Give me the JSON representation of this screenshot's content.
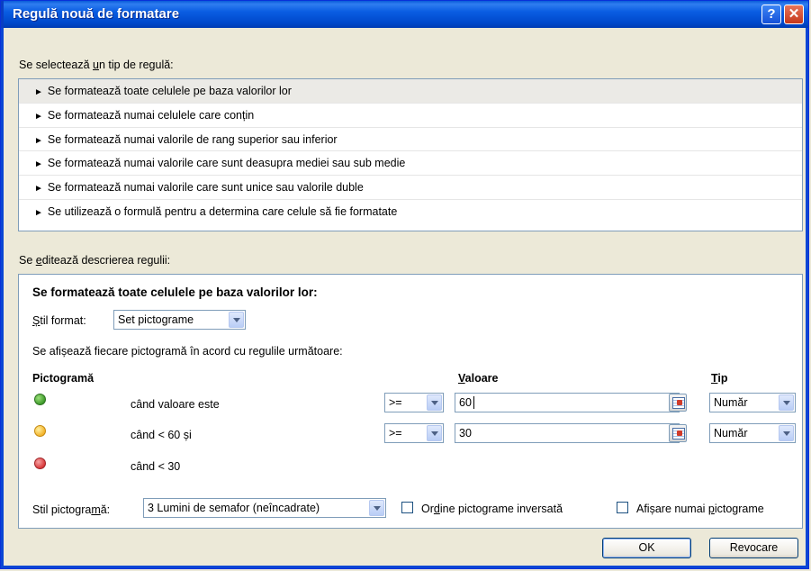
{
  "window": {
    "title": "Regulă nouă de formatare"
  },
  "titlebar": {
    "help_glyph": "?",
    "close_glyph": "✕"
  },
  "rule_type": {
    "label_pre": "Se selectează ",
    "label_key": "u",
    "label_post": "n tip de regulă:",
    "items": [
      "Se formatează toate celulele pe baza valorilor lor",
      "Se formatează numai celulele care conțin",
      "Se formatează numai valorile de rang superior sau inferior",
      "Se formatează numai valorile care sunt deasupra mediei sau sub medie",
      "Se formatează numai valorile care sunt unice sau valorile duble",
      "Se utilizează o formulă pentru a determina care celule să fie formatate"
    ],
    "selected_index": 0,
    "arrow_glyph": "►"
  },
  "description": {
    "label_pre": "Se ",
    "label_key": "e",
    "label_post": "ditează descrierea regulii:",
    "title": "Se formatează toate celulele pe baza valorilor lor:",
    "format_style_label_key": "Ș",
    "format_style_label_post": "til format:",
    "format_style_value": "Set pictograme",
    "rules_caption": "Se afișează fiecare pictogramă în acord cu regulile următoare:",
    "col_icon": "Pictogramă",
    "col_value_key": "V",
    "col_value_post": "aloare",
    "col_type_key": "T",
    "col_type_post": "ip",
    "rows": [
      {
        "icon": "green-light-icon",
        "condition": "când valoare este",
        "operator": ">=",
        "value": "60",
        "type": "Număr"
      },
      {
        "icon": "yellow-light-icon",
        "condition": "când < 60 și",
        "operator": ">=",
        "value": "30",
        "type": "Număr"
      },
      {
        "icon": "red-light-icon",
        "condition": "când < 30"
      }
    ],
    "icon_style_label_pre": "Stil pictogra",
    "icon_style_label_key": "m",
    "icon_style_label_post": "ă:",
    "icon_style_value": "3 Lumini de semafor (neîncadrate)",
    "reverse_order_label_pre": "Or",
    "reverse_order_label_key": "d",
    "reverse_order_label_post": "ine pictograme inversată",
    "reverse_order_checked": false,
    "show_icon_only_label_pre": "Afișare numai ",
    "show_icon_only_label_key": "p",
    "show_icon_only_label_post": "ictograme",
    "show_icon_only_checked": false
  },
  "buttons": {
    "ok": "OK",
    "cancel": "Revocare"
  },
  "colors": {
    "titlebar": "#0a5de2",
    "dialog_bg": "#ece9d8",
    "green": "#3e9a2a",
    "yellow": "#f3b32b",
    "red": "#d9393b"
  }
}
